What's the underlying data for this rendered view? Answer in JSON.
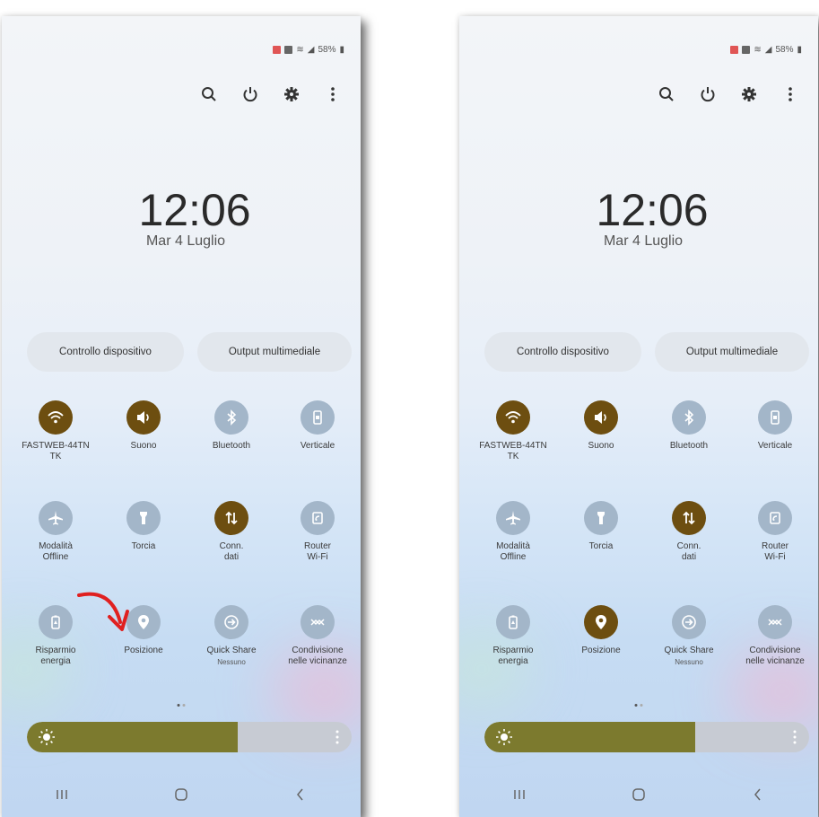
{
  "colors": {
    "tile_on": "#6d4e10",
    "tile_off": "#a3b6c9",
    "brightness_fill": "#7c7a2e",
    "annotation_arrow": "#e02020"
  },
  "status": {
    "battery": "58%"
  },
  "clock": {
    "time": "12:06",
    "date": "Mar 4 Luglio"
  },
  "toolbar": {
    "icons": [
      "search-icon",
      "power-icon",
      "settings-gear-icon",
      "more-vertical-icon"
    ]
  },
  "pills": {
    "device_control": "Controllo dispositivo",
    "media_output": "Output multimediale"
  },
  "tiles": {
    "wifi": "FASTWEB-44TN\nTK",
    "sound": "Suono",
    "bluetooth": "Bluetooth",
    "rotation": "Verticale",
    "airplane": "Modalità\nOffline",
    "flashlight": "Torcia",
    "mobile_data": "Conn.\ndati",
    "hotspot": "Router\nWi-Fi",
    "power_saving": "Risparmio\nenergia",
    "location": "Posizione",
    "quick_share": "Quick Share",
    "quick_share_sub": "Nessuno",
    "nearby_share": "Condivisione\nnelle vicinanze"
  },
  "screens": [
    {
      "name": "before",
      "location_enabled": false
    },
    {
      "name": "after",
      "location_enabled": true
    }
  ],
  "brightness": {
    "level": 0.65
  },
  "nav": {
    "icons": [
      "recent-apps-icon",
      "home-icon",
      "back-icon"
    ]
  }
}
